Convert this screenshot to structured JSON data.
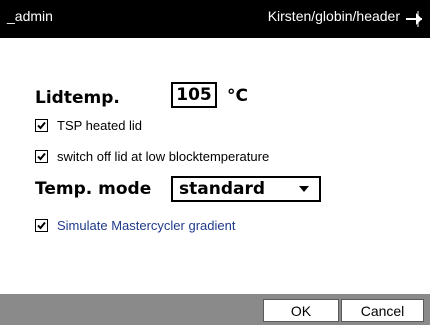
{
  "titlebar": {
    "user": "_admin",
    "path": "Kirsten/globin/header",
    "nav_icon": "navigation-arrow-icon"
  },
  "lid": {
    "label": "Lidtemp.",
    "value": "105",
    "unit": "°C"
  },
  "checkboxes": {
    "tsp_heated_lid": {
      "label": "TSP heated lid",
      "checked": true
    },
    "switch_off_lid": {
      "label": "switch off lid at low blocktemperature",
      "checked": true
    },
    "simulate_gradient": {
      "label": "Simulate Mastercycler gradient",
      "checked": true
    }
  },
  "temp_mode": {
    "label": "Temp. mode",
    "selected": "standard"
  },
  "buttons": {
    "ok": "OK",
    "cancel": "Cancel"
  },
  "colors": {
    "titlebar_bg": "#000000",
    "bottombar_bg": "#8a8a8a",
    "accent_text": "#1f3a8a"
  }
}
